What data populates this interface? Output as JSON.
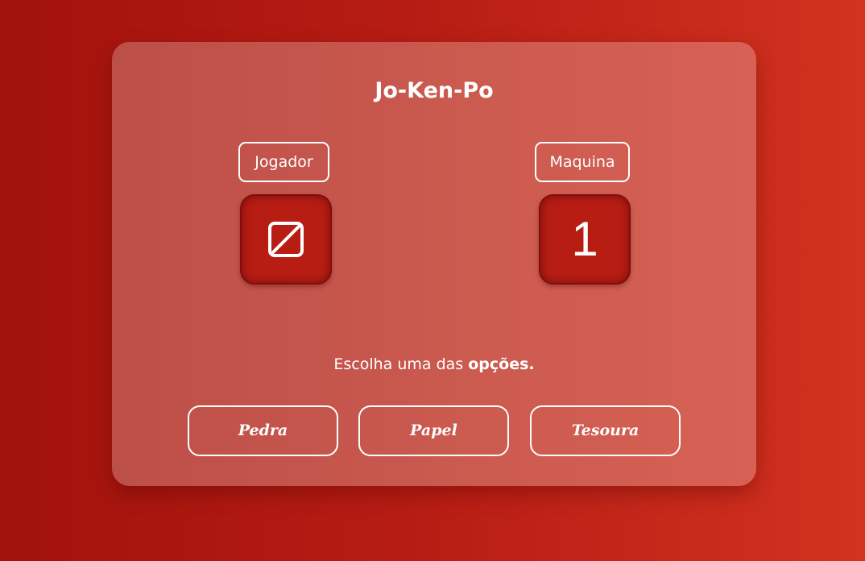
{
  "app": {
    "title": "Jo-Ken-Po"
  },
  "players": {
    "player_label": "Jogador",
    "machine_label": "Maquina",
    "player_choice_icon": "empty-choice-icon",
    "machine_value": "1"
  },
  "message": {
    "prefix": "Escolha uma das ",
    "emphasis": "opções."
  },
  "options": {
    "pedra": "Pedra",
    "papel": "Papel",
    "tesoura": "Tesoura"
  },
  "colors": {
    "background_start": "#a1120c",
    "background_end": "#d2321f",
    "card": "#cb5a4f",
    "box": "#b81d14",
    "text": "#ffffff"
  }
}
